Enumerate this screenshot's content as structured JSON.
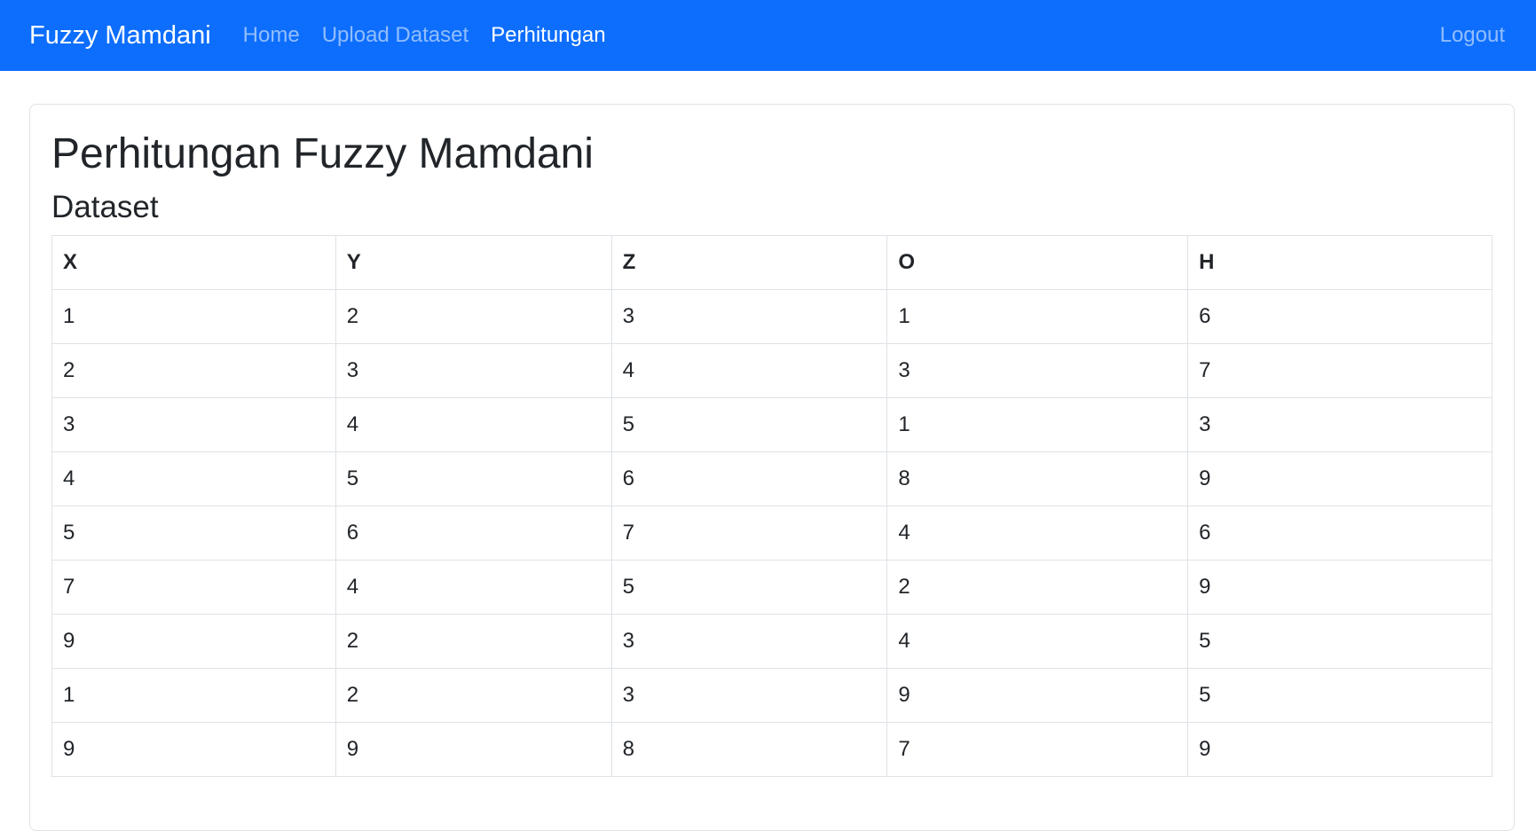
{
  "navbar": {
    "brand": "Fuzzy Mamdani",
    "links": [
      {
        "label": "Home"
      },
      {
        "label": "Upload Dataset"
      },
      {
        "label": "Perhitungan"
      }
    ],
    "logout": "Logout",
    "bg_color": "#0d6efd"
  },
  "main": {
    "title": "Perhitungan Fuzzy Mamdani",
    "section_title": "Dataset",
    "table": {
      "headers": [
        "X",
        "Y",
        "Z",
        "O",
        "H"
      ],
      "rows": [
        [
          "1",
          "2",
          "3",
          "1",
          "6"
        ],
        [
          "2",
          "3",
          "4",
          "3",
          "7"
        ],
        [
          "3",
          "4",
          "5",
          "1",
          "3"
        ],
        [
          "4",
          "5",
          "6",
          "8",
          "9"
        ],
        [
          "5",
          "6",
          "7",
          "4",
          "6"
        ],
        [
          "7",
          "4",
          "5",
          "2",
          "9"
        ],
        [
          "9",
          "2",
          "3",
          "4",
          "5"
        ],
        [
          "1",
          "2",
          "3",
          "9",
          "5"
        ],
        [
          "9",
          "9",
          "8",
          "7",
          "9"
        ]
      ]
    }
  }
}
